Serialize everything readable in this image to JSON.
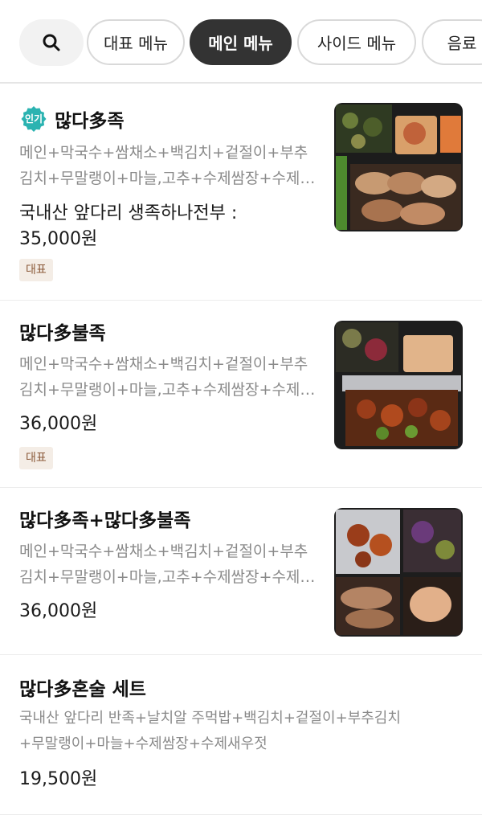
{
  "categories": [
    {
      "label": "대표 메뉴",
      "active": false
    },
    {
      "label": "메인 메뉴",
      "active": true
    },
    {
      "label": "사이드 메뉴",
      "active": false
    },
    {
      "label": "음료",
      "active": false
    }
  ],
  "badge_popular": "인기",
  "menu": [
    {
      "name": "많다多족",
      "desc": [
        "메인+막국수+쌈채소+백김치+겉절이+부추",
        "김치+무말랭이+마늘,고추+수제쌈장+수제…"
      ],
      "price": [
        "국내산 앞다리 생족하나전부 :",
        "35,000원"
      ],
      "tag": "대표"
    },
    {
      "name": "많다多불족",
      "desc": [
        "메인+막국수+쌈채소+백김치+겉절이+부추",
        "김치+무말랭이+마늘,고추+수제쌈장+수제…"
      ],
      "price": [
        "36,000원"
      ],
      "tag": "대표"
    },
    {
      "name": "많다多족+많다多불족",
      "desc": [
        "메인+막국수+쌈채소+백김치+겉절이+부추",
        "김치+무말랭이+마늘,고추+수제쌈장+수제…"
      ],
      "price": [
        "36,000원"
      ]
    },
    {
      "name": "많다多혼술 세트",
      "desc": [
        "국내산 앞다리 반족+날치알 주먹밥+백김치+겉절이+부추김치",
        "+무말랭이+마늘+수제쌈장+수제새우젓"
      ],
      "price": [
        "19,500원"
      ]
    }
  ]
}
